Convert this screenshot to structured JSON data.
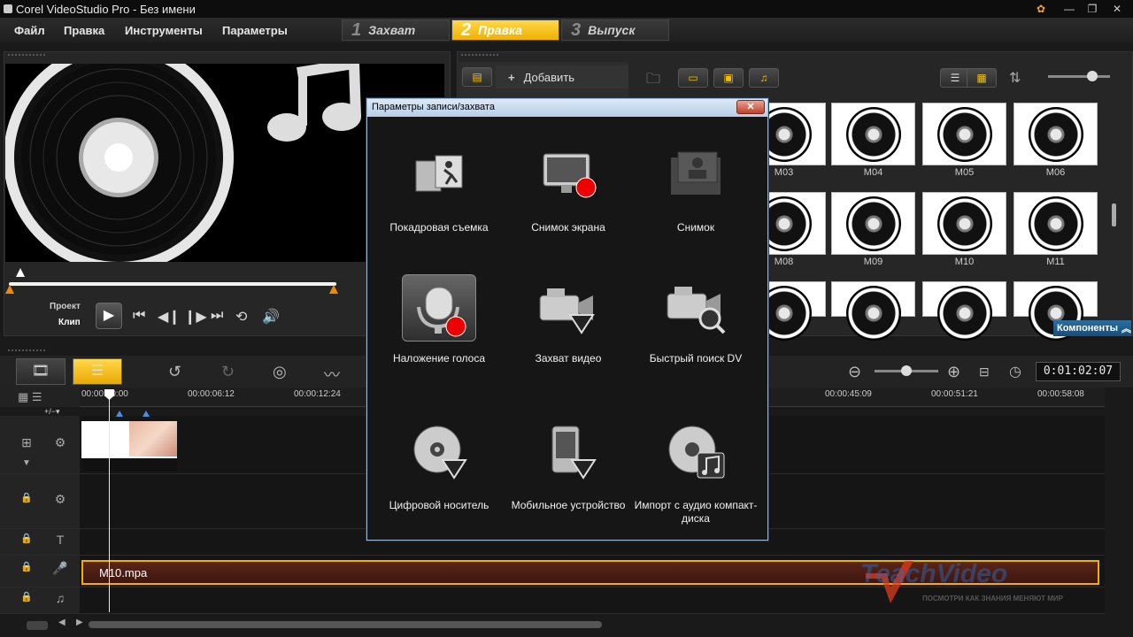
{
  "window": {
    "title": "Corel VideoStudio Pro - Без имени"
  },
  "menu": [
    "Файл",
    "Правка",
    "Инструменты",
    "Параметры"
  ],
  "steps": [
    {
      "num": "1",
      "label": "Захват"
    },
    {
      "num": "2",
      "label": "Правка",
      "active": true
    },
    {
      "num": "3",
      "label": "Выпуск"
    }
  ],
  "preview": {
    "mode_project": "Проект",
    "mode_clip": "Клип"
  },
  "library": {
    "add_label": "Добавить",
    "thumbnails": [
      "M03",
      "M04",
      "M05",
      "M06",
      "M08",
      "M09",
      "M10",
      "M11",
      "",
      "",
      "",
      ""
    ],
    "components_label": "Компоненты"
  },
  "timeline": {
    "ruler": [
      "00:00:00:00",
      "00:00:06:12",
      "00:00:12:24",
      "00:00:45:09",
      "00:00:51:21",
      "00:00:58:08"
    ],
    "timecode": "0:01:02:07",
    "audio_clip": "M10.mpa",
    "scale_label": "+/−▾"
  },
  "dialog": {
    "title": "Параметры записи/захвата",
    "close_label": "✕",
    "items": [
      {
        "label": "Покадровая съемка"
      },
      {
        "label": "Снимок экрана"
      },
      {
        "label": "Снимок"
      },
      {
        "label": "Наложение голоса",
        "selected": true
      },
      {
        "label": "Захват видео"
      },
      {
        "label": "Быстрый поиск DV"
      },
      {
        "label": "Цифровой носитель"
      },
      {
        "label": "Мобильное устройство"
      },
      {
        "label": "Импорт с аудио компакт-диска"
      }
    ]
  },
  "watermark": {
    "brand": "TeachVideo",
    "slogan": "ПОСМОТРИ КАК ЗНАНИЯ МЕНЯЮТ МИР"
  },
  "colors": {
    "accent": "#f0b000",
    "dialog_frame": "#9cb7d6",
    "close": "#c0402a",
    "audio_clip": "#4a1c12"
  }
}
